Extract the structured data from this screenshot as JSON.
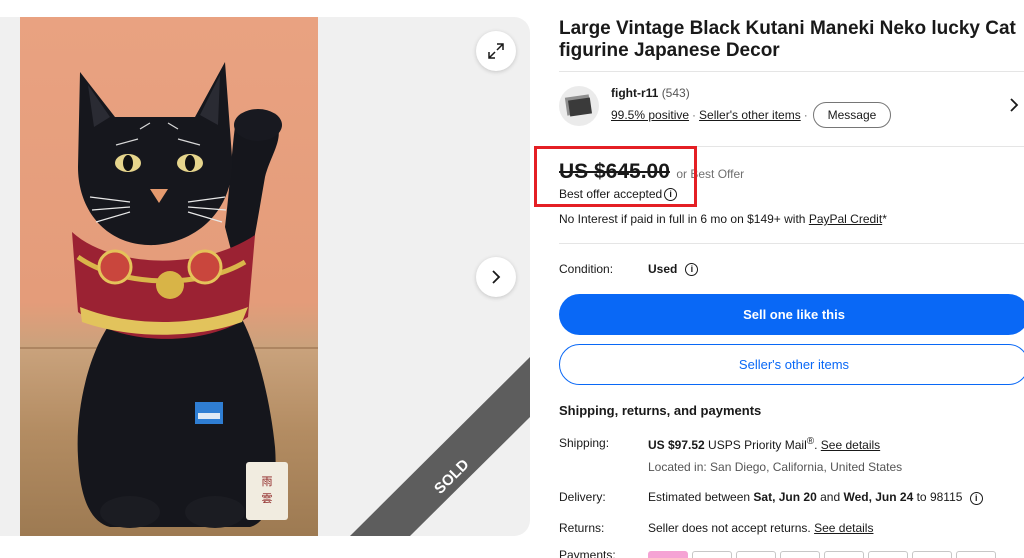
{
  "listing": {
    "title": "Large Vintage Black Kutani Maneki Neko lucky Cat figurine Japanese Decor",
    "sold_badge": "SOLD"
  },
  "seller": {
    "name": "fight-r11",
    "feedback_count": "(543)",
    "positive": "99.5% positive",
    "other_items_link": "Seller's other items",
    "message_button": "Message"
  },
  "price": {
    "amount": "US $645.00",
    "or_offer": "or Best Offer",
    "offer_status": "Best offer accepted",
    "financing_text": "No Interest if paid in full in 6 mo on $149+ with ",
    "financing_link": "PayPal Credit",
    "financing_suffix": "*"
  },
  "condition": {
    "label": "Condition:",
    "value": "Used"
  },
  "actions": {
    "primary": "Sell one like this",
    "secondary": "Seller's other items"
  },
  "shipping": {
    "heading": "Shipping, returns, and payments",
    "shipping_label": "Shipping:",
    "shipping_cost": "US $97.52",
    "shipping_method": " USPS Priority Mail",
    "shipping_reg": "®",
    "shipping_dot": ". ",
    "see_details": "See details",
    "located": "Located in: San Diego, California, United States",
    "delivery_label": "Delivery:",
    "delivery_prefix": "Estimated between ",
    "delivery_start": "Sat, Jun 20",
    "delivery_and": " and ",
    "delivery_end": "Wed, Jun 24",
    "delivery_suffix": " to 98115",
    "returns_label": "Returns:",
    "returns_text": "Seller does not accept returns. ",
    "returns_link": "See details",
    "payments_label": "Payments:"
  },
  "icons": {
    "expand": "expand-icon",
    "next": "chevron-right-icon",
    "info": "info-icon"
  },
  "colors": {
    "accent_blue": "#0968f6",
    "highlight_red": "#e41f24"
  }
}
